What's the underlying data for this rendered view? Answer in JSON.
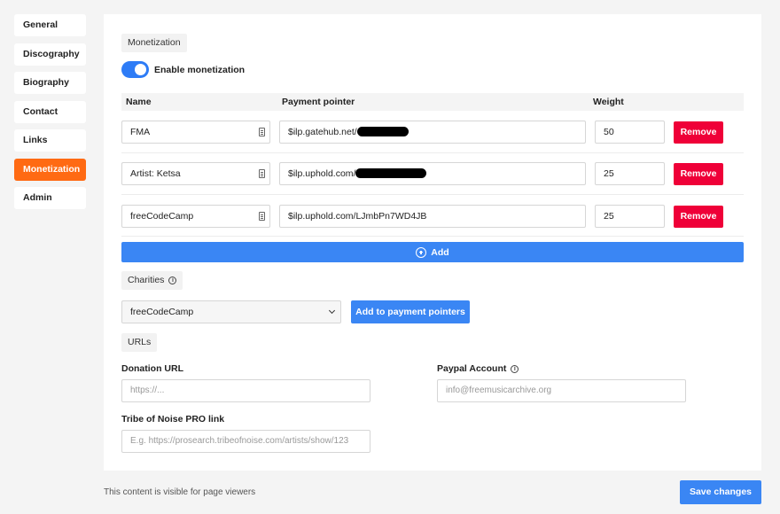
{
  "sidebar": {
    "items": [
      {
        "label": "General",
        "active": false
      },
      {
        "label": "Discography",
        "active": false
      },
      {
        "label": "Biography",
        "active": false
      },
      {
        "label": "Contact",
        "active": false
      },
      {
        "label": "Links",
        "active": false
      },
      {
        "label": "Monetization",
        "active": true
      },
      {
        "label": "Admin",
        "active": false
      }
    ]
  },
  "monetization": {
    "section_label": "Monetization",
    "toggle_label": "Enable monetization",
    "toggle_on": true,
    "columns": {
      "name": "Name",
      "pointer": "Payment pointer",
      "weight": "Weight"
    },
    "rows": [
      {
        "name": "FMA",
        "pointer": "$ilp.gatehub.net/",
        "pointer_redacted": true,
        "weight": "50",
        "remove_label": "Remove"
      },
      {
        "name": "Artist: Ketsa",
        "pointer": "$ilp.uphold.com/",
        "pointer_redacted": true,
        "weight": "25",
        "remove_label": "Remove"
      },
      {
        "name": "freeCodeCamp",
        "pointer": "$ilp.uphold.com/LJmbPn7WD4JB",
        "pointer_redacted": false,
        "weight": "25",
        "remove_label": "Remove"
      }
    ],
    "add_label": "Add"
  },
  "charities": {
    "section_label": "Charities",
    "selected": "freeCodeCamp",
    "add_button": "Add to payment pointers"
  },
  "urls": {
    "section_label": "URLs",
    "donation_label": "Donation URL",
    "donation_placeholder": "https://...",
    "paypal_label": "Paypal Account",
    "paypal_placeholder": "info@freemusicarchive.org",
    "tribe_label": "Tribe of Noise PRO link",
    "tribe_placeholder": "E.g. https://prosearch.tribeofnoise.com/artists/show/123"
  },
  "footer": {
    "visibility_text": "This content is visible for page viewers",
    "save_label": "Save changes"
  },
  "colors": {
    "accent": "#3a86f4",
    "active_nav": "#ff6a13",
    "danger": "#ef0038"
  }
}
